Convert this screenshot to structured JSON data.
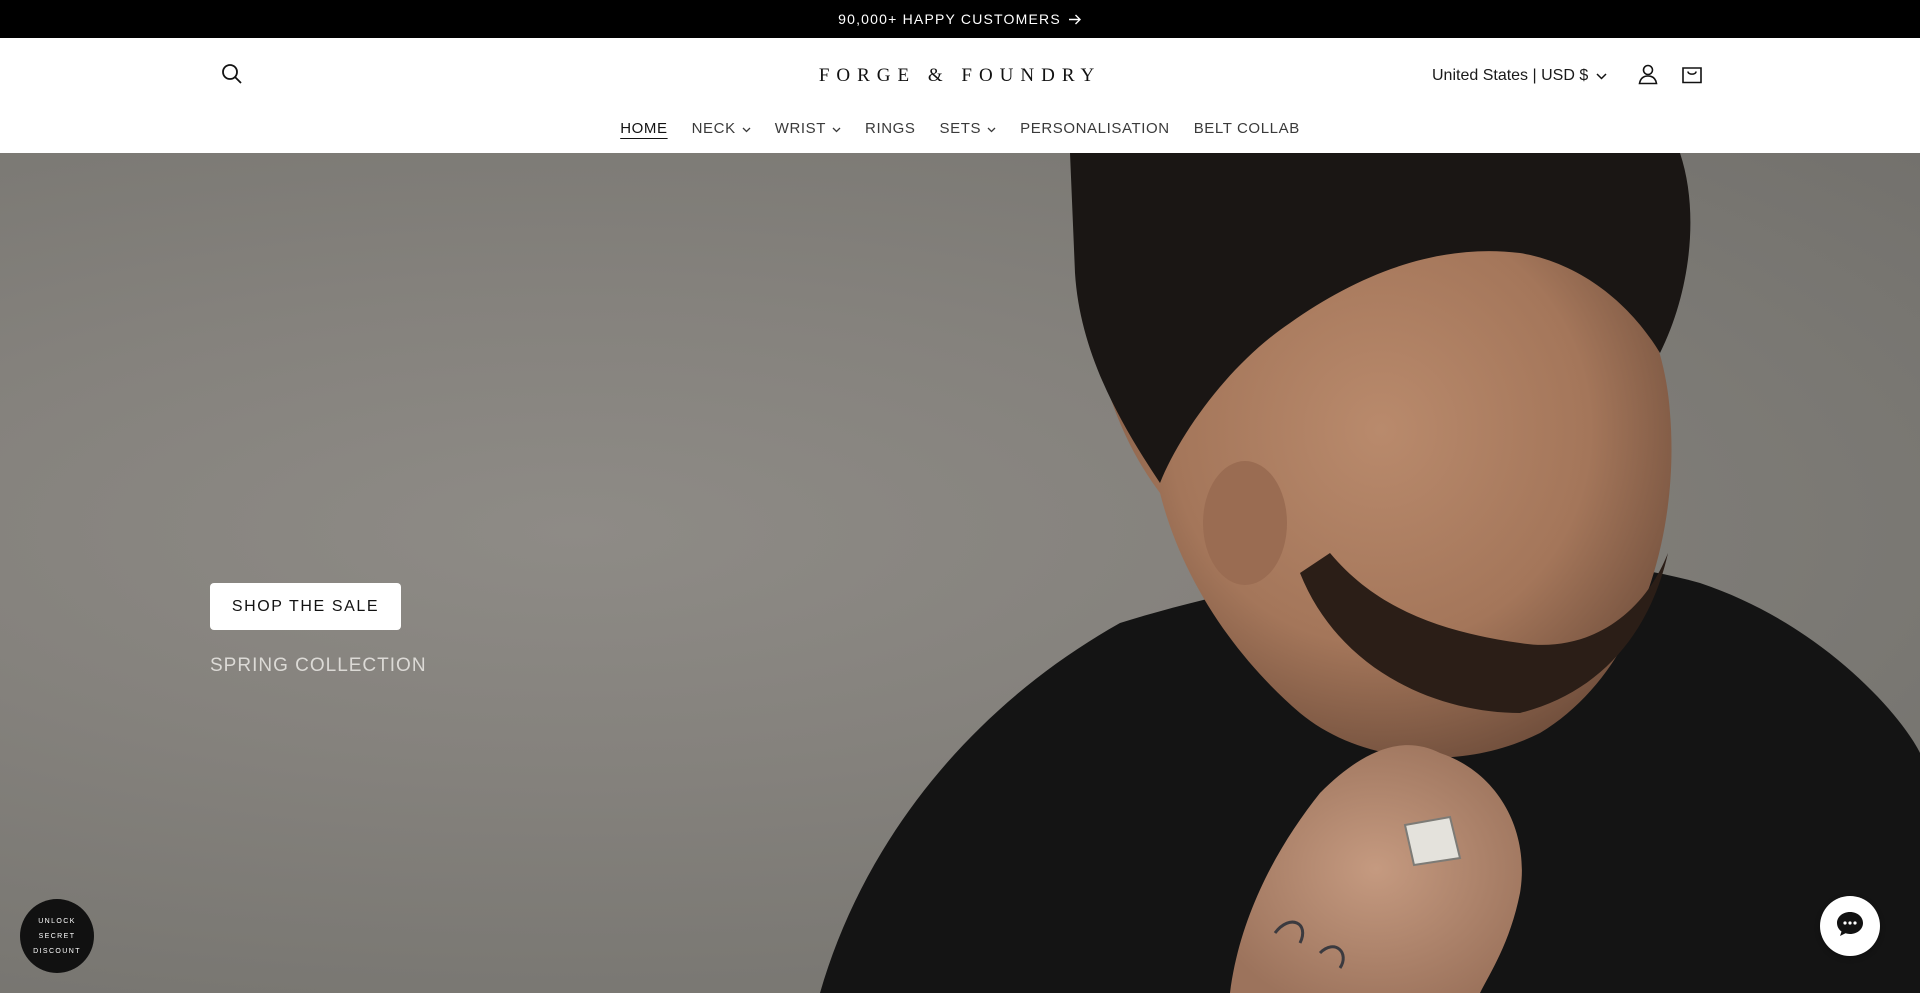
{
  "announcement": {
    "text": "90,000+ HAPPY CUSTOMERS",
    "icon": "arrow-right-icon"
  },
  "header": {
    "logo": "FORGE & FOUNDRY",
    "locale": "United States | USD $",
    "icons": {
      "search": "search-icon",
      "account": "user-icon",
      "cart": "cart-icon"
    }
  },
  "nav": {
    "items": [
      {
        "label": "HOME",
        "active": true,
        "has_dropdown": false
      },
      {
        "label": "NECK",
        "active": false,
        "has_dropdown": true
      },
      {
        "label": "WRIST",
        "active": false,
        "has_dropdown": true
      },
      {
        "label": "RINGS",
        "active": false,
        "has_dropdown": false
      },
      {
        "label": "SETS",
        "active": false,
        "has_dropdown": true
      },
      {
        "label": "PERSONALISATION",
        "active": false,
        "has_dropdown": false
      },
      {
        "label": "BELT COLLAB",
        "active": false,
        "has_dropdown": false
      }
    ]
  },
  "hero": {
    "button_label": "SHOP THE SALE",
    "subheading": "SPRING COLLECTION"
  },
  "discount_badge": {
    "lines": [
      "UNLOCK",
      "SECRET",
      "DISCOUNT"
    ]
  },
  "chat": {
    "icon": "chat-bubble-icon"
  },
  "colors": {
    "announcement_bg": "#000000",
    "hero_bg": "#85827d",
    "button_bg": "#ffffff",
    "badge_bg": "#111111"
  }
}
